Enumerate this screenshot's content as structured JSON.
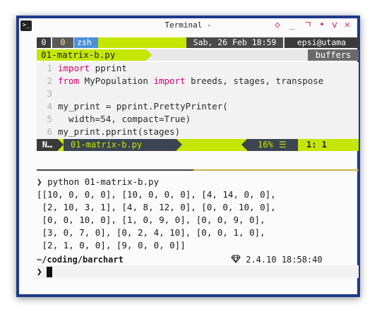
{
  "window": {
    "title": "Terminal -",
    "controls": [
      "◇",
      "_",
      "ㄱ",
      "•",
      "ⅴ",
      "✕"
    ]
  },
  "tmux": {
    "window_index": "0",
    "pane_index": "0",
    "session_name": "zsh",
    "datetime": "Sab, 26 Feb 18:59",
    "user_host": "epsi@utama"
  },
  "editor": {
    "tab_file": "01-matrix-b.py",
    "buffers_label": "buffers",
    "lines": [
      {
        "n": "1",
        "code": [
          [
            "kw",
            "import"
          ],
          [
            "p",
            " pprint"
          ]
        ]
      },
      {
        "n": "2",
        "code": [
          [
            "kw",
            "from"
          ],
          [
            "p",
            " MyPopulation "
          ],
          [
            "kw",
            "import"
          ],
          [
            "p",
            " breeds, stages, transpose"
          ]
        ]
      },
      {
        "n": "3",
        "code": []
      },
      {
        "n": "4",
        "code": [
          [
            "p",
            "my_print = pprint.PrettyPrinter("
          ]
        ]
      },
      {
        "n": "5",
        "code": [
          [
            "p",
            "  width="
          ],
          [
            "num",
            "54"
          ],
          [
            "p",
            ", compact="
          ],
          [
            "bool",
            "True"
          ],
          [
            "p",
            ")"
          ]
        ]
      },
      {
        "n": "6",
        "code": [
          [
            "p",
            "my_print.pprint(stages)"
          ]
        ]
      }
    ],
    "status": {
      "mode": "N…",
      "file": "01-matrix-b.py",
      "percent": "16%",
      "menu_symbol": "☰",
      "position": "1:  1"
    }
  },
  "shell": {
    "command_prompt": "❯",
    "command": "python 01-matrix-b.py",
    "output": [
      "[[10, 0, 0, 0], [10, 0, 0, 0], [4, 14, 0, 0],",
      " [2, 10, 3, 1], [4, 8, 12, 0], [0, 0, 10, 0],",
      " [0, 0, 10, 0], [1, 0, 9, 0], [0, 0, 9, 0],",
      " [3, 0, 7, 0], [0, 2, 4, 10], [0, 0, 1, 0],",
      " [2, 1, 0, 0], [9, 0, 0, 0]]"
    ],
    "cwd": "~/coding/barchart",
    "version_icon": "gem-icon",
    "version": "2.4.10",
    "time": "18:58:40",
    "input_prompt": "❯"
  },
  "colors": {
    "frame": "#1f3a8a",
    "accent": "#c5e600",
    "keyword": "#d9006c",
    "tmux_dark": "#3b3b3b",
    "tmux_blue": "#4a90d9"
  }
}
